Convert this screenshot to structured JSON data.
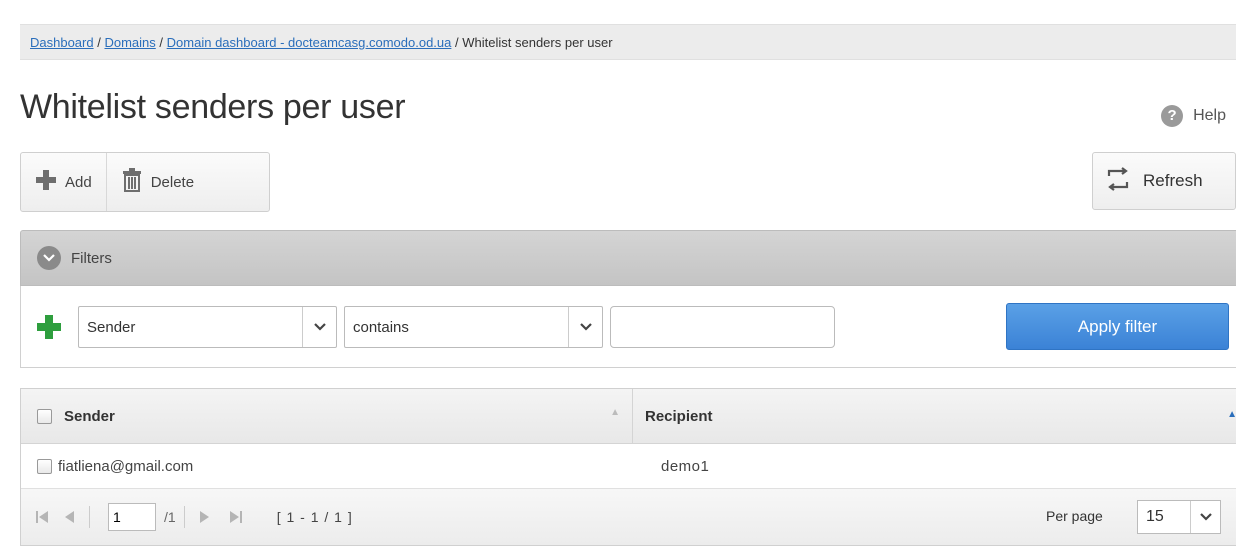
{
  "breadcrumb": {
    "items": [
      "Dashboard",
      "Domains",
      "Domain dashboard - docteamcasg.comodo.od.ua"
    ],
    "current": "Whitelist senders per user",
    "separator": "/"
  },
  "page": {
    "title": "Whitelist senders per user"
  },
  "help": {
    "icon_char": "?",
    "label": "Help"
  },
  "toolbar": {
    "add_label": "Add",
    "delete_label": "Delete",
    "refresh_label": "Refresh"
  },
  "filters": {
    "title": "Filters",
    "field_value": "Sender",
    "operator_value": "contains",
    "value": "",
    "apply_label": "Apply filter"
  },
  "table": {
    "columns": [
      "Sender",
      "Recipient"
    ],
    "rows": [
      {
        "sender": "fiatliena@gmail.com",
        "recipient": "demo1"
      }
    ]
  },
  "pagination": {
    "current_page": "1",
    "total_pages": "/1",
    "range": "[ 1 - 1 / 1 ]",
    "per_page_label": "Per page",
    "per_page_value": "15"
  },
  "colors": {
    "link": "#2a6ebb",
    "apply_button": "#3b82d6",
    "add_green": "#2e9e3e"
  },
  "icons": [
    "help-icon",
    "plus-icon",
    "trash-icon",
    "refresh-icon",
    "chevron-down-icon",
    "add-filter-icon",
    "sort-asc-icon",
    "first-page-icon",
    "prev-page-icon",
    "next-page-icon",
    "last-page-icon"
  ]
}
